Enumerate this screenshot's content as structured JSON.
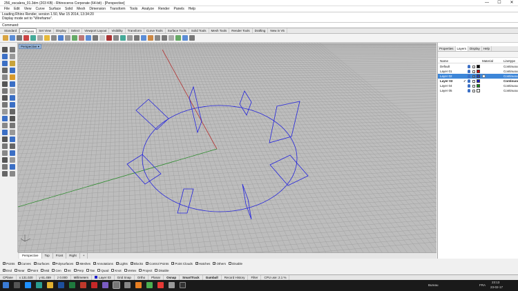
{
  "window": {
    "title": "256_escalera_01.3dm (203 KB) - Rhinoceros Corporate (64-bit) - [Perspective]",
    "controls": [
      "—",
      "☐",
      "✕"
    ]
  },
  "menu": [
    "File",
    "Edit",
    "View",
    "Curve",
    "Surface",
    "Solid",
    "Mesh",
    "Dimension",
    "Transform",
    "Tools",
    "Analyze",
    "Render",
    "Panels",
    "Help"
  ],
  "command_history": [
    "Loading Rhino Render, version 1.50, Mar 15 2014, 13:34:20",
    "Display mode set to \"Wireframe\"."
  ],
  "command_prompt": "Command:",
  "toolbar_tabs": [
    "Standard",
    "CPlanes",
    "Set View",
    "Display",
    "Select",
    "Viewport Layout",
    "Visibility",
    "Transform",
    "Curve Tools",
    "Surface Tools",
    "Solid Tools",
    "Mesh Tools",
    "Render Tools",
    "Drafting",
    "New in V5"
  ],
  "active_toolbar_tab": "CPlanes",
  "viewport": {
    "title": "Perspective",
    "tabs": [
      "Perspective",
      "Top",
      "Front",
      "Right"
    ],
    "add_tab": "+",
    "axis_labels": {
      "z": "z",
      "x": "x",
      "y": "y"
    }
  },
  "panel": {
    "tabs": [
      "Properties",
      "Layers",
      "Display",
      "Help"
    ],
    "active_tab": "Layers",
    "columns": {
      "name": "Name",
      "material": "Material",
      "linetype": "Linetype"
    },
    "layers": [
      {
        "name": "Default",
        "color": "#000000",
        "linetype": "Continuous",
        "current": false,
        "selected": false
      },
      {
        "name": "Layer 01",
        "color": "#cc0000",
        "linetype": "Continuous",
        "current": false,
        "selected": false
      },
      {
        "name": "Layer 02",
        "color": "#1a3fbf",
        "linetype": "Continuous",
        "current": false,
        "selected": true
      },
      {
        "name": "Layer 03",
        "color": "#1a1acc",
        "linetype": "Continuous",
        "current": true,
        "selected": false
      },
      {
        "name": "Layer 04",
        "color": "#1a8f1a",
        "linetype": "Continuous",
        "current": false,
        "selected": false
      },
      {
        "name": "Layer 05",
        "color": "#ffffff",
        "linetype": "Continuous",
        "current": false,
        "selected": false
      }
    ],
    "checkmark": "✓"
  },
  "selection_filters": [
    {
      "label": "Points",
      "checked": true
    },
    {
      "label": "Curves",
      "checked": true
    },
    {
      "label": "Surfaces",
      "checked": true
    },
    {
      "label": "Polysurfaces",
      "checked": true
    },
    {
      "label": "Meshes",
      "checked": true
    },
    {
      "label": "Annotations",
      "checked": true
    },
    {
      "label": "Lights",
      "checked": true
    },
    {
      "label": "Blocks",
      "checked": true
    },
    {
      "label": "Control Points",
      "checked": true
    },
    {
      "label": "Point Clouds",
      "checked": true
    },
    {
      "label": "Hatches",
      "checked": true
    },
    {
      "label": "Others",
      "checked": true
    },
    {
      "label": "Disable",
      "checked": false
    }
  ],
  "osnaps": [
    {
      "label": "End",
      "checked": true
    },
    {
      "label": "Near",
      "checked": false
    },
    {
      "label": "Point",
      "checked": false
    },
    {
      "label": "Mid",
      "checked": false
    },
    {
      "label": "Cen",
      "checked": false
    },
    {
      "label": "Int",
      "checked": false
    },
    {
      "label": "Perp",
      "checked": false
    },
    {
      "label": "Tan",
      "checked": false
    },
    {
      "label": "Quad",
      "checked": false
    },
    {
      "label": "Knot",
      "checked": false
    },
    {
      "label": "Vertex",
      "checked": false
    },
    {
      "label": "Project",
      "checked": false
    },
    {
      "label": "Disable",
      "checked": false
    }
  ],
  "status": {
    "cplane": "CPlane",
    "x": "x 131.020",
    "y": "y 61.459",
    "z": "z 0.000",
    "units": "Millimeters",
    "layer": "Layer 03",
    "grid_snap": "Grid Snap",
    "ortho": "Ortho",
    "planar": "Planar",
    "osnap": "Osnap",
    "smarttrack": "SmartTrack",
    "gumball": "Gumball",
    "record_history": "Record History",
    "filter": "Filter",
    "cpu": "CPU use: 2.1 %"
  },
  "taskbar": {
    "tray_label": "Bureau",
    "language": "FRA",
    "time": "23:13",
    "date": "23-02-17"
  },
  "colors": {
    "grid_bg": "#bdbdbd",
    "grid_line": "#9a9a9a",
    "curve": "#2222dd",
    "x_axis": "#b33333",
    "y_axis": "#2a8a2a",
    "selected_row": "#3d86d8"
  }
}
